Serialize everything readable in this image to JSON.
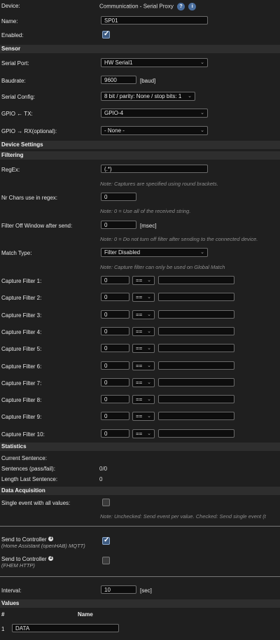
{
  "header": {
    "device_label": "Device:",
    "device_value": "Communication - Serial Proxy",
    "help_icon": "?",
    "info_icon": "i",
    "name_label": "Name:",
    "name_value": "SP01",
    "enabled_label": "Enabled:"
  },
  "sensor": {
    "title": "Sensor",
    "serial_port_label": "Serial Port:",
    "serial_port_value": "HW Serial1",
    "baudrate_label": "Baudrate:",
    "baudrate_value": "9600",
    "baudrate_unit": "[baud]",
    "serial_config_label": "Serial Config:",
    "serial_config_value": "8 bit / parity: None / stop bits: 1",
    "gpio_tx_label": "GPIO ← TX:",
    "gpio_tx_value": "GPIO-4",
    "gpio_rx_label": "GPIO → RX(optional):",
    "gpio_rx_value": "- None -"
  },
  "device_settings": {
    "title": "Device Settings"
  },
  "filtering": {
    "title": "Filtering",
    "regex_label": "RegEx:",
    "regex_value": "(.*)",
    "regex_note": "Note: Captures are specified using round brackets.",
    "nrchars_label": "Nr Chars use in regex:",
    "nrchars_value": "0",
    "nrchars_note": "Note: 0 = Use all of the received string.",
    "filteroff_label": "Filter Off Window after send:",
    "filteroff_value": "0",
    "filteroff_unit": "[msec]",
    "filteroff_note": "Note: 0 = Do not turn off filter after sending to the connected device.",
    "matchtype_label": "Match Type:",
    "matchtype_value": "Filter Disabled",
    "matchtype_note": "Note: Capture filter can only be used on Global Match",
    "capture_filters": [
      {
        "label": "Capture Filter 1:",
        "index": "0",
        "op": "=="
      },
      {
        "label": "Capture Filter 2:",
        "index": "0",
        "op": "=="
      },
      {
        "label": "Capture Filter 3:",
        "index": "0",
        "op": "=="
      },
      {
        "label": "Capture Filter 4:",
        "index": "0",
        "op": "=="
      },
      {
        "label": "Capture Filter 5:",
        "index": "0",
        "op": "=="
      },
      {
        "label": "Capture Filter 6:",
        "index": "0",
        "op": "=="
      },
      {
        "label": "Capture Filter 7:",
        "index": "0",
        "op": "=="
      },
      {
        "label": "Capture Filter 8:",
        "index": "0",
        "op": "=="
      },
      {
        "label": "Capture Filter 9:",
        "index": "0",
        "op": "=="
      },
      {
        "label": "Capture Filter 10:",
        "index": "0",
        "op": "=="
      }
    ]
  },
  "statistics": {
    "title": "Statistics",
    "current_label": "Current Sentence:",
    "sentences_label": "Sentences (pass/fail):",
    "sentences_value": "0/0",
    "length_label": "Length Last Sentence:",
    "length_value": "0"
  },
  "data_acquisition": {
    "title": "Data Acquisition",
    "single_event_label": "Single event with all values:",
    "single_event_note": "Note: Unchecked: Send event per value. Checked: Send single event (t",
    "controller1_label": "Send to Controller",
    "controller1_icon": "1",
    "controller1_sub": "(Home Assistant (openHAB) MQTT)",
    "controller2_label": "Send to Controller",
    "controller2_icon": "2",
    "controller2_sub": "(FHEM HTTP)",
    "interval_label": "Interval:",
    "interval_value": "10",
    "interval_unit": "[sec]"
  },
  "values": {
    "title": "Values",
    "col_num": "#",
    "col_name": "Name",
    "rows": [
      {
        "num": "1",
        "name": "DATA"
      }
    ]
  },
  "colors": {
    "accent": "#4a6e9e",
    "background": "#1f1f1f",
    "section": "#2e2e2e"
  }
}
